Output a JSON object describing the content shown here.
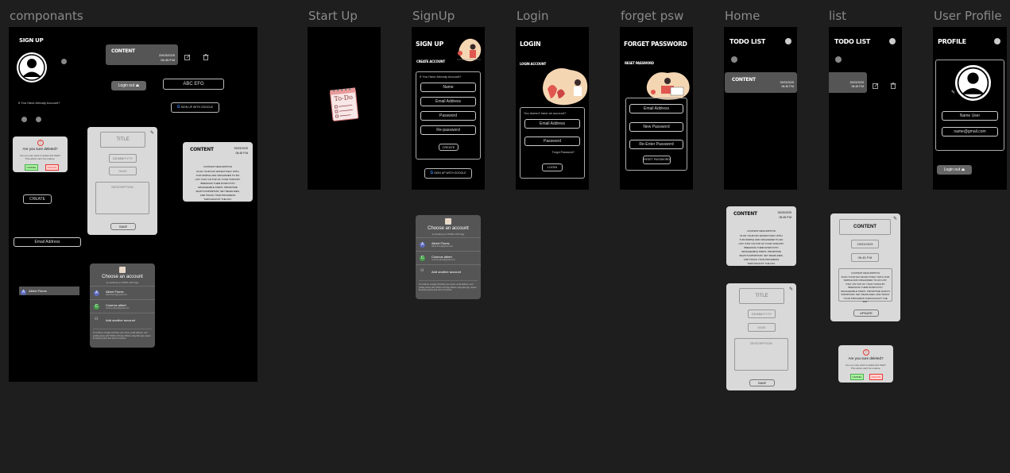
{
  "frames": {
    "componants": "componants",
    "startup": "Start Up",
    "signup": "SignUp",
    "login": "Login",
    "forget": "forget psw",
    "home": "Home",
    "list": "list",
    "profile": "User Profile"
  },
  "components": {
    "signup_title": "SIGN UP",
    "content_chip_title": "CONTENT",
    "content_chip_date": "29/03/2025",
    "content_chip_time": "06:45 P.M",
    "logout_label": "Login out",
    "abc_label": "ABC EFG",
    "google_label": "SIGN UP WITH GOOGLE",
    "have_account": "If You Have Already Account?",
    "delete_question": "Are you sure deleted?",
    "delete_sub": "Are you sure want to delete this Task? This action can't be undone.",
    "cancel": "CANCEL",
    "delete": "DELETE",
    "create": "CREATE",
    "email": "Email Address",
    "title_field": "TITLE",
    "date_field": "DD/MM/YYYY",
    "time_field": "00:00",
    "description_field": "DESCRIPTION",
    "save": "SAVE",
    "detail_title": "CONTENT",
    "detail_date": "29/03/2025",
    "detail_time": "06:45 P.M",
    "detail_desc_title": "CONTENT DESCRIPTION",
    "detail_desc": "PLAN YOUR DAY EFFECTIVELY WITH THIS SIMPLE AND ORGANIZED TO-DO LIST. STAY ON TOP OF YOUR TASKS BY BREAKING THEM DOWN INTO MANAGEABLE STEPS. PRIORITIZE WHAT'S IMPORTANT, SET DEADLINES, AND TRACK YOUR PROGRESS THROUGHOUT THE DAY.",
    "chooser_title": "Choose an account",
    "chooser_sub": "to continue to TODO LIST App",
    "account1_name": "Albert Flores",
    "account1_email": "albert.flores@gmail.com",
    "account2_name": "Cosmos albert",
    "account2_email": "cosmos.albert@gmail.com",
    "add_account": "Add another account",
    "chooser_footer": "To continue, Google will share your name, email address, and profile picture with TODO LIST App. Before using this app, review its privacy policy and terms of service.",
    "account_chip": "Albert Flores",
    "account_chip_letter": "A"
  },
  "startup": {
    "logo_text": "To-Do"
  },
  "signup": {
    "title": "SIGN UP",
    "subtitle": "CREATE ACCOUNT",
    "already": "If You Have Already Account?",
    "name": "Name",
    "email": "Email Address",
    "password": "Password",
    "repassword": "Re-password",
    "create": "CREATE",
    "google": "SIGN UP WITH GOOGLE"
  },
  "login": {
    "title": "LOGIN",
    "subtitle": "LOGIN ACCOUNT",
    "no_account": "You doesn't have an account?",
    "email": "Email Address",
    "password": "Password",
    "forgot": "Forgot Password?",
    "login_btn": "LOGIN"
  },
  "forget": {
    "title": "FORGET PASSWORD",
    "subtitle": "RESET PASSWORD",
    "email": "Email Address",
    "new_password": "New Password",
    "reenter": "Re-Enter Password",
    "reset_btn": "RESET PASSWORD"
  },
  "home": {
    "title": "TODO LIST",
    "item_title": "CONTENT",
    "item_date": "29/03/2025",
    "item_time": "06:45 P.M",
    "detail_title": "CONTENT",
    "detail_date": "29/03/2025",
    "detail_time": "06:45 P.M",
    "detail_desc_title": "CONTENT DESCRIPTION",
    "detail_desc": "PLAN YOUR DAY EFFECTIVELY WITH THIS SIMPLE AND ORGANIZED TO-DO LIST. STAY ON TOP OF YOUR TASKS BY BREAKING THEM DOWN INTO MANAGEABLE STEPS. PRIORITIZE WHAT'S IMPORTANT, SET DEADLINES, AND TRACK YOUR PROGRESS THROUGHOUT THE DAY.",
    "form_title": "TITLE",
    "form_date": "DD/MM/YYYY",
    "form_time": "00:00",
    "form_desc": "DESCRIPTION",
    "form_save": "SAVE"
  },
  "list": {
    "title": "TODO LIST",
    "item_date": "29/03/2025",
    "item_time": "06:45 P.M",
    "edit_title": "CONTENT",
    "edit_date": "29/03/2025",
    "edit_time": "06:45 P.M",
    "edit_desc_title": "CONTENT DESCRIPTION",
    "edit_desc": "PLAN YOUR DAY EFFECTIVELY WITH THIS SIMPLE AND ORGANIZED TO-DO LIST. STAY ON TOP OF YOUR TASKS BY BREAKING THEM DOWN INTO MANAGEABLE STEPS. PRIORITIZE WHAT'S IMPORTANT, SET DEADLINES, AND TRACK YOUR PROGRESS THROUGHOUT THE DAY.",
    "edit_update": "UPDATE",
    "delete_question": "Are you sure deleted?",
    "delete_sub": "Are you sure want to delete this Task? This action can't be undone.",
    "cancel": "CANCEL",
    "delete": "DELETE"
  },
  "profile": {
    "title": "PROFILE",
    "name": "Name User",
    "email": "name@gmail.com",
    "logout": "Login out"
  },
  "colors": {
    "canvas": "#1e1e1e",
    "frame": "#000000",
    "card": "#d9d9d9",
    "dark_card": "#555555",
    "delete_red": "#e53935",
    "confirm_green": "#4caf50"
  }
}
